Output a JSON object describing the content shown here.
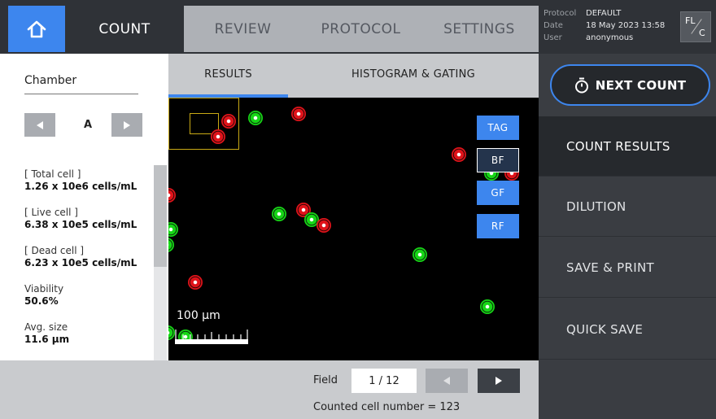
{
  "nav": {
    "tabs": [
      "COUNT",
      "REVIEW",
      "PROTOCOL",
      "SETTINGS"
    ],
    "active": "COUNT"
  },
  "info": {
    "protocol_label": "Protocol",
    "protocol_value": "DEFAULT",
    "date_label": "Date",
    "date_value": "18 May 2023 13:58",
    "user_label": "User",
    "user_value": "anonymous"
  },
  "mode_badge": {
    "top": "FL",
    "bottom": "C"
  },
  "chamber": {
    "title": "Chamber",
    "selected": "A"
  },
  "stats": [
    {
      "label": "[ Total cell ]",
      "value": "1.26 x 10e6 cells/mL"
    },
    {
      "label": "[ Live cell ]",
      "value": "6.38 x 10e5 cells/mL"
    },
    {
      "label": "[ Dead cell ]",
      "value": "6.23 x 10e5 cells/mL"
    },
    {
      "label": "Viability",
      "value": "50.6%"
    },
    {
      "label": "Avg. size",
      "value": "11.6 µm"
    }
  ],
  "subtabs": {
    "results": "RESULTS",
    "histogram": "HISTOGRAM & GATING",
    "active": "RESULTS"
  },
  "image_filters": [
    "TAG",
    "BF",
    "GF",
    "RF"
  ],
  "image_filter_selected": "BF",
  "scale_label": "100 µm",
  "field": {
    "label": "Field",
    "value": "1 / 12"
  },
  "counted_text": "Counted cell number = 123",
  "sidebar": {
    "next_count": "NEXT COUNT",
    "items": [
      "COUNT RESULTS",
      "DILUTION",
      "SAVE & PRINT",
      "QUICK SAVE"
    ],
    "active": "COUNT RESULTS"
  },
  "colors": {
    "accent": "#3d86ee",
    "live_cell": "#16d716",
    "dead_cell": "#e0131a",
    "zoom_box": "#c9a915"
  }
}
